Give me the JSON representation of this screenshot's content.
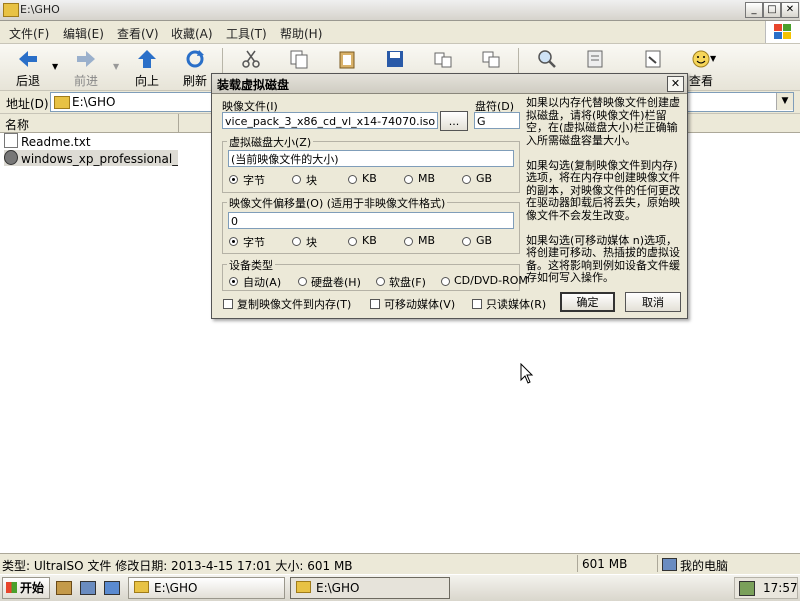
{
  "window": {
    "title": "E:\\GHO",
    "min": "_",
    "max": "□",
    "close": "✕"
  },
  "menu": [
    "文件(F)",
    "编辑(E)",
    "查看(V)",
    "收藏(A)",
    "工具(T)",
    "帮助(H)"
  ],
  "toolbar": {
    "back": "后退",
    "forward": "前进",
    "up": "向上",
    "refresh": "刷新",
    "view": "查看"
  },
  "address": {
    "label": "地址(D)",
    "value": "E:\\GHO"
  },
  "list": {
    "column_name": "名称",
    "files": [
      "Readme.txt",
      "windows_xp_professional_wit..."
    ]
  },
  "status": {
    "info": "类型: UltraISO 文件 修改日期: 2013-4-15 17:01 大小: 601 MB",
    "size": "601 MB",
    "location": "我的电脑"
  },
  "taskbar": {
    "start": "开始",
    "task1": "E:\\GHO",
    "task2": "E:\\GHO",
    "clock": "17:57"
  },
  "dialog": {
    "title": "装载虚拟磁盘",
    "image_file_label": "映像文件(I)",
    "image_file_value": "vice_pack_3_x86_cd_vl_x14-74070.iso",
    "browse": "...",
    "drive_label": "盘符(D)",
    "drive_value": "G",
    "size_group": "虚拟磁盘大小(Z)",
    "size_value": "(当前映像文件的大小)",
    "units": [
      "字节",
      "块",
      "KB",
      "MB",
      "GB"
    ],
    "offset_group": "映像文件偏移量(O) (适用于非映像文件格式)",
    "offset_value": "0",
    "device_group": "设备类型",
    "devices": [
      "自动(A)",
      "硬盘卷(H)",
      "软盘(F)",
      "CD/DVD-ROM"
    ],
    "cb_copy": "复制映像文件到内存(T)",
    "cb_removable": "可移动媒体(V)",
    "cb_readonly": "只读媒体(R)",
    "ok": "确定",
    "cancel": "取消",
    "help": "如果以内存代替映像文件创建虚拟磁盘，请将(映像文件)栏留空，在(虚拟磁盘大小)栏正确输入所需磁盘容量大小。\n\n如果勾选(复制映像文件到内存)选项，将在内存中创建映像文件的副本，对映像文件的任何更改在驱动器卸载后将丢失，原始映像文件不会发生改变。\n\n如果勾选(可移动媒体 n)选项，将创建可移动、热插拔的虚拟设备。这将影响到例如设备文件缓存如何写入操作。"
  },
  "colors": {
    "accent": "#2a6fc8",
    "dialog_bg": "#ece9d8",
    "taskbar": "#e2dfd6"
  }
}
